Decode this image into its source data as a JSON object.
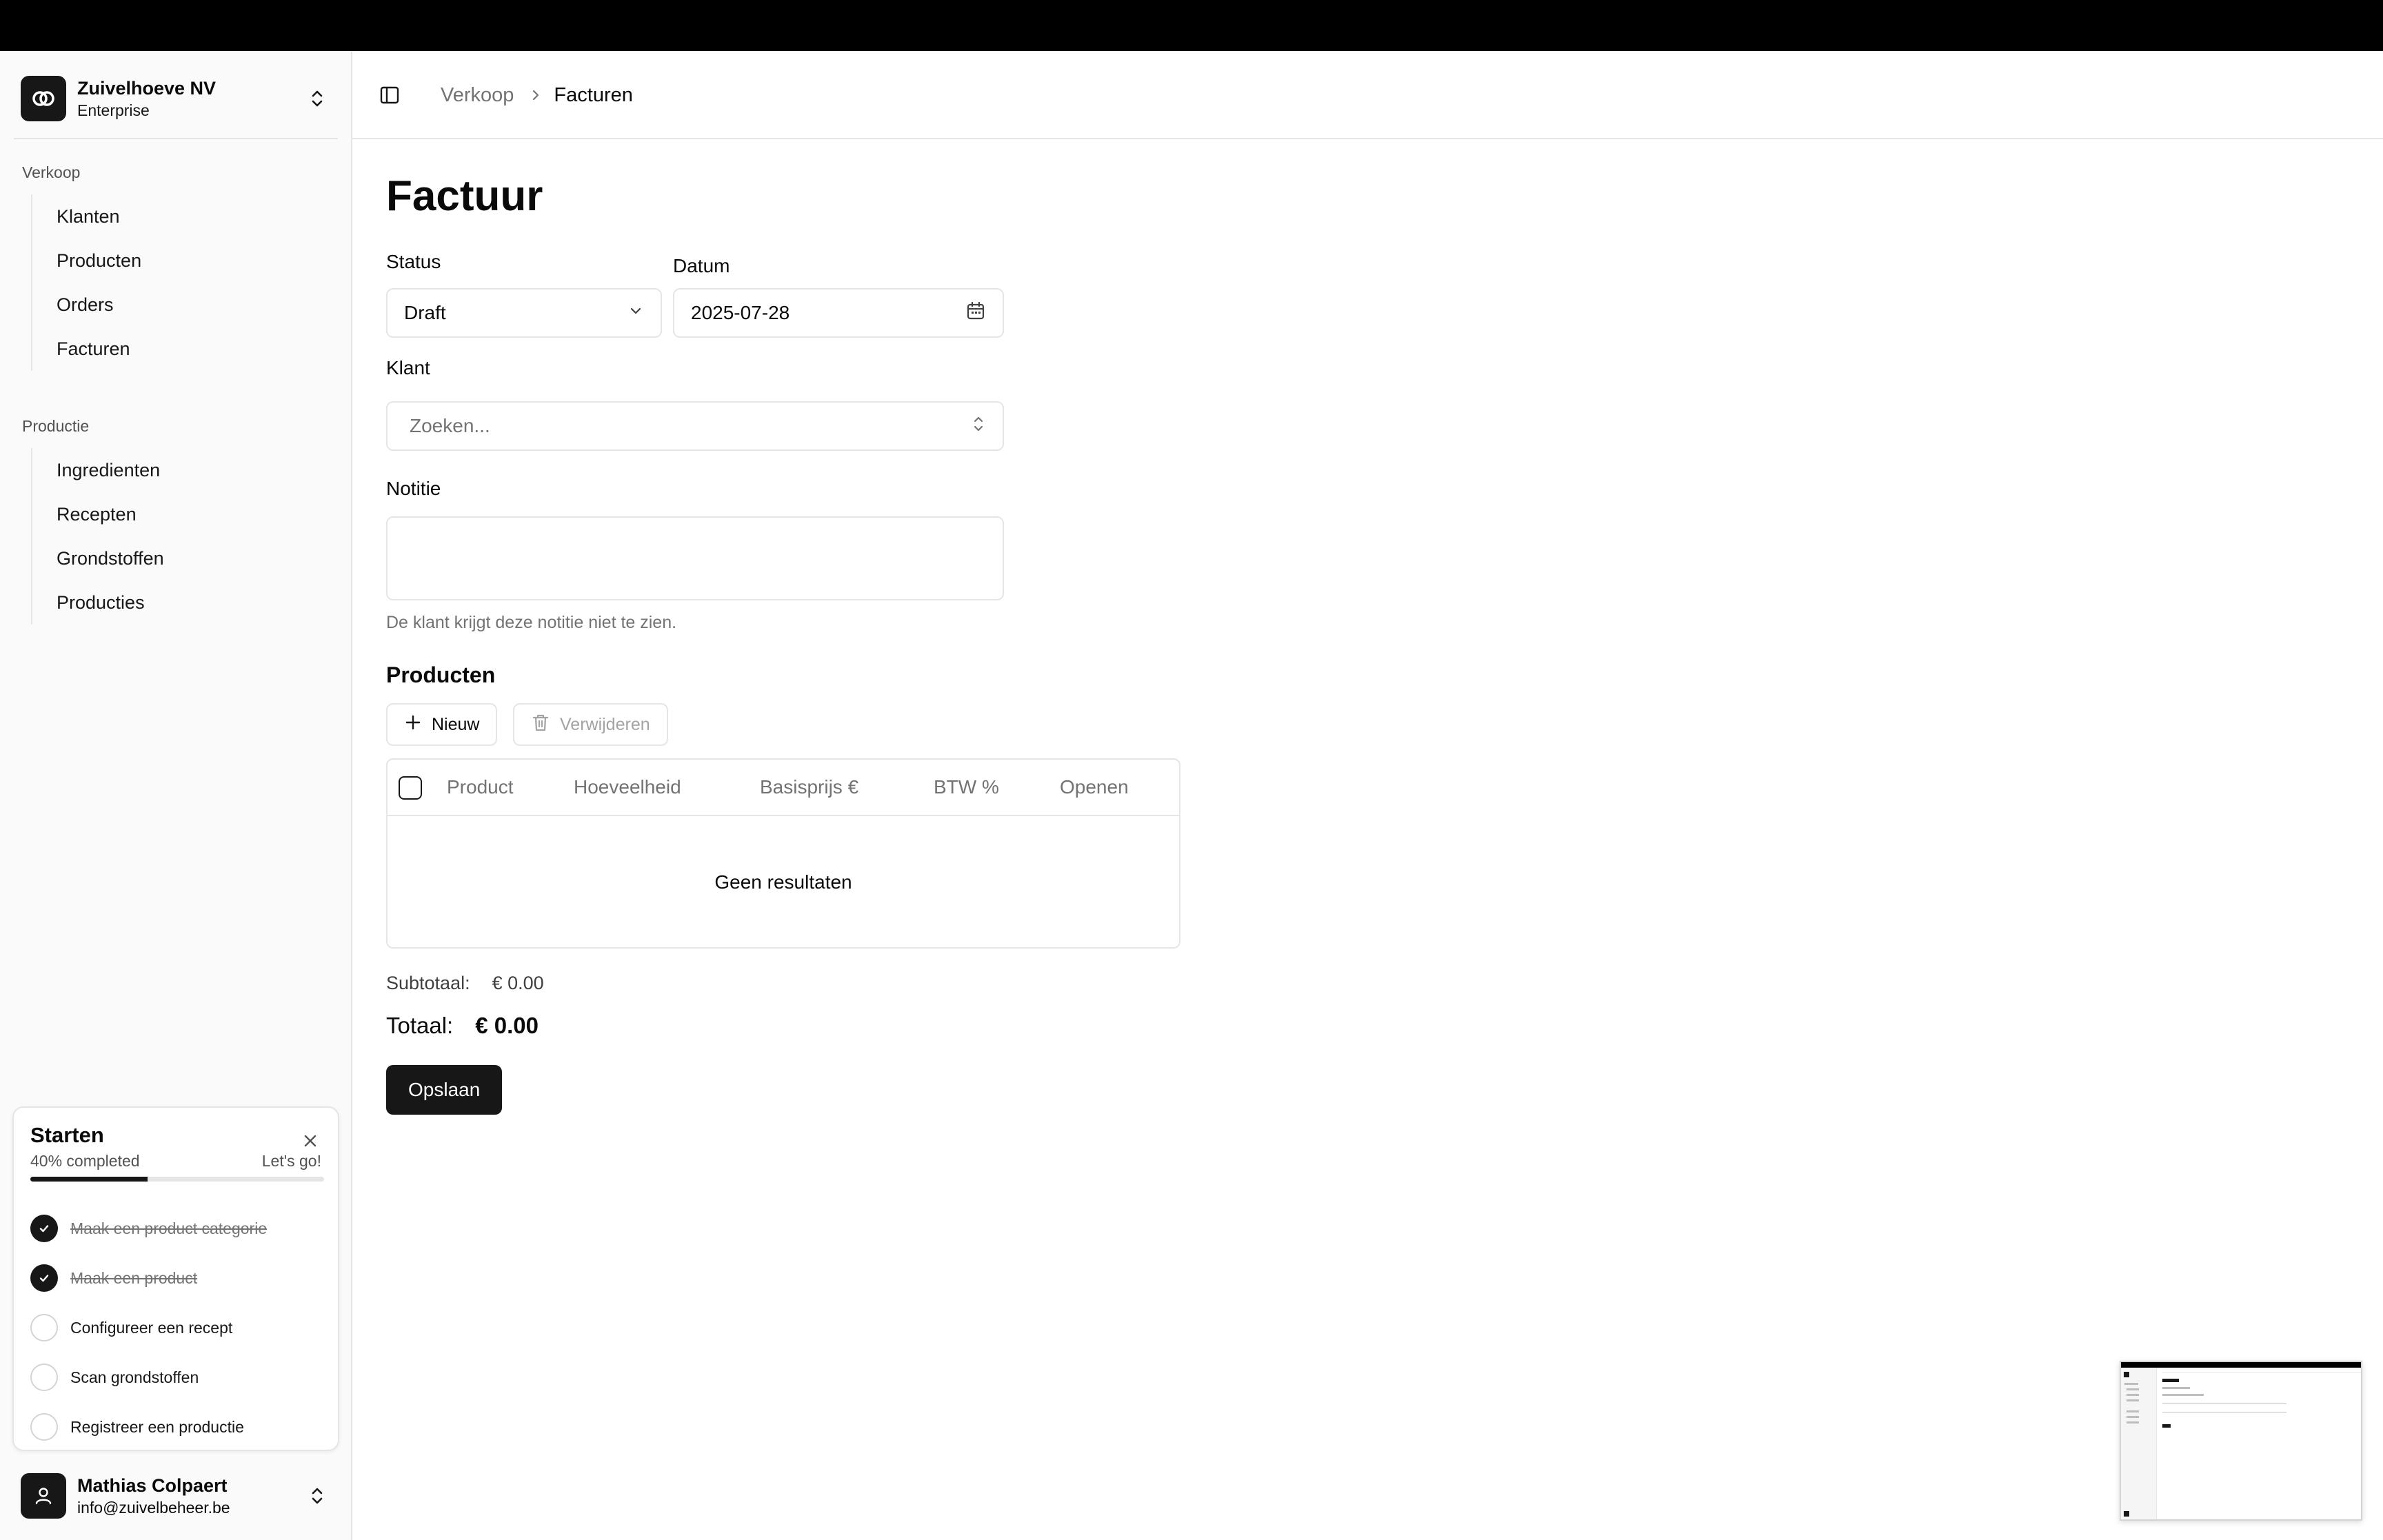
{
  "org": {
    "name": "Zuivelhoeve NV",
    "plan": "Enterprise"
  },
  "sidebar": {
    "groups": [
      {
        "label": "Verkoop",
        "items": [
          "Klanten",
          "Producten",
          "Orders",
          "Facturen"
        ]
      },
      {
        "label": "Productie",
        "items": [
          "Ingredienten",
          "Recepten",
          "Grondstoffen",
          "Producties"
        ]
      }
    ]
  },
  "onboarding": {
    "title": "Starten",
    "progress_text": "40% completed",
    "progress": 0.4,
    "cta": "Let's go!",
    "tasks": [
      {
        "label": "Maak een product categorie",
        "done": true
      },
      {
        "label": "Maak een product",
        "done": true
      },
      {
        "label": "Configureer een recept",
        "done": false
      },
      {
        "label": "Scan grondstoffen",
        "done": false
      },
      {
        "label": "Registreer een productie",
        "done": false
      }
    ]
  },
  "user": {
    "name": "Mathias Colpaert",
    "email": "info@zuivelbeheer.be"
  },
  "breadcrumb": {
    "parent": "Verkoop",
    "current": "Facturen"
  },
  "form": {
    "title": "Factuur",
    "status_label": "Status",
    "status_value": "Draft",
    "date_label": "Datum",
    "date_value": "2025-07-28",
    "client_label": "Klant",
    "client_placeholder": "Zoeken...",
    "note_label": "Notitie",
    "note_value": "",
    "note_hint": "De klant krijgt deze notitie niet te zien."
  },
  "products": {
    "title": "Producten",
    "new_label": "Nieuw",
    "delete_label": "Verwijderen",
    "columns": [
      "Product",
      "Hoeveelheid",
      "Basisprijs €",
      "BTW %",
      "Openen"
    ],
    "empty_text": "Geen resultaten"
  },
  "totals": {
    "subtotal_label": "Subtotaal:",
    "subtotal_value": "€ 0.00",
    "total_label": "Totaal:",
    "total_value": "€ 0.00"
  },
  "save_label": "Opslaan"
}
